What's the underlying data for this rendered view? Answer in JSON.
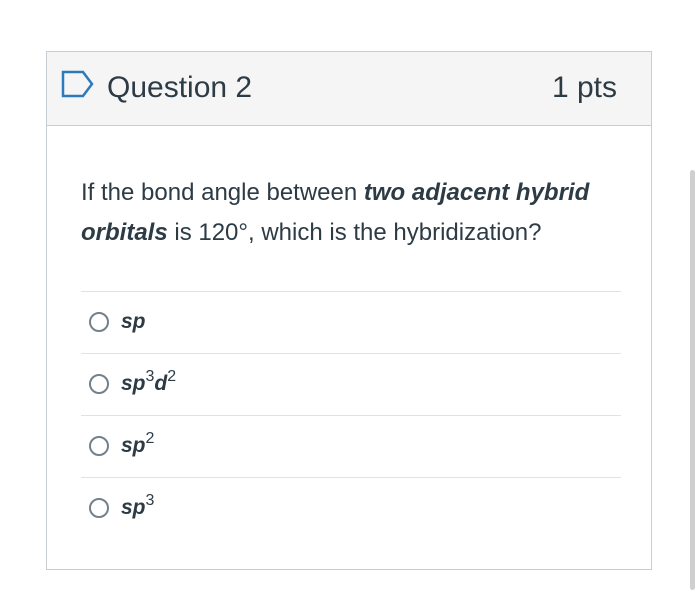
{
  "question": {
    "title": "Question 2",
    "points": "1 pts",
    "text": {
      "part1": "If the bond angle between ",
      "bold1": "two adjacent hybrid",
      "bold2": "orbitals",
      "part2": " is 120°, which is the hybridization?"
    },
    "icon": "flag-outline-icon"
  },
  "answers": [
    {
      "base": "sp",
      "sup1": "",
      "mid": "",
      "sup2": ""
    },
    {
      "base": "sp",
      "sup1": "3",
      "mid": "d",
      "sup2": "2"
    },
    {
      "base": "sp",
      "sup1": "2",
      "mid": "",
      "sup2": ""
    },
    {
      "base": "sp",
      "sup1": "3",
      "mid": "",
      "sup2": ""
    }
  ],
  "colors": {
    "text": "#2d3b45",
    "header_bg": "#f5f5f5",
    "border": "#c7cdd1",
    "flag": "#2b7abc"
  }
}
